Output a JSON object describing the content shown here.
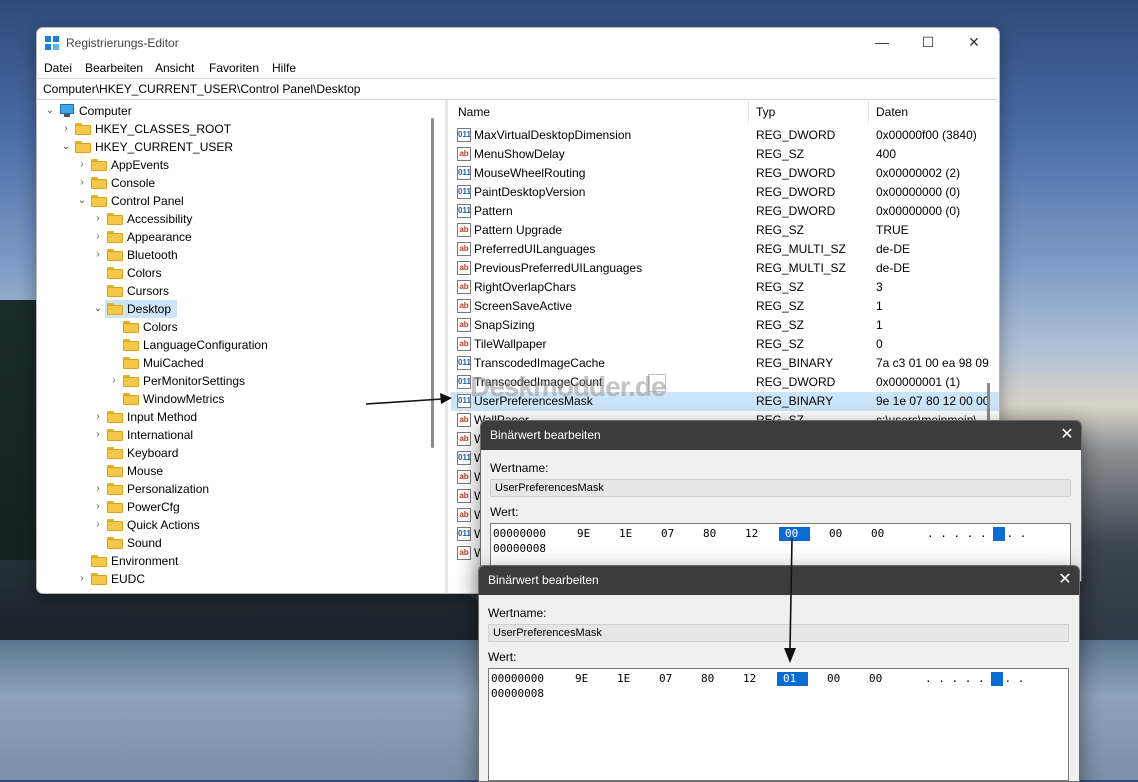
{
  "window": {
    "title": "Registrierungs-Editor",
    "minimize": "—",
    "maximize": "☐",
    "close": "✕"
  },
  "menu": [
    "Datei",
    "Bearbeiten",
    "Ansicht",
    "Favoriten",
    "Hilfe"
  ],
  "address": "Computer\\HKEY_CURRENT_USER\\Control Panel\\Desktop",
  "tree": [
    {
      "label": "Computer",
      "level": 0,
      "arrow": "⌄",
      "icon": "computer-icon"
    },
    {
      "label": "HKEY_CLASSES_ROOT",
      "level": 1,
      "arrow": "›"
    },
    {
      "label": "HKEY_CURRENT_USER",
      "level": 1,
      "arrow": "⌄"
    },
    {
      "label": "AppEvents",
      "level": 2,
      "arrow": "›"
    },
    {
      "label": "Console",
      "level": 2,
      "arrow": "›"
    },
    {
      "label": "Control Panel",
      "level": 2,
      "arrow": "⌄"
    },
    {
      "label": "Accessibility",
      "level": 3,
      "arrow": "›"
    },
    {
      "label": "Appearance",
      "level": 3,
      "arrow": "›"
    },
    {
      "label": "Bluetooth",
      "level": 3,
      "arrow": "›"
    },
    {
      "label": "Colors",
      "level": 3,
      "arrow": ""
    },
    {
      "label": "Cursors",
      "level": 3,
      "arrow": ""
    },
    {
      "label": "Desktop",
      "level": 3,
      "arrow": "⌄",
      "selected": true
    },
    {
      "label": "Colors",
      "level": 4,
      "arrow": ""
    },
    {
      "label": "LanguageConfiguration",
      "level": 4,
      "arrow": ""
    },
    {
      "label": "MuiCached",
      "level": 4,
      "arrow": ""
    },
    {
      "label": "PerMonitorSettings",
      "level": 4,
      "arrow": "›"
    },
    {
      "label": "WindowMetrics",
      "level": 4,
      "arrow": ""
    },
    {
      "label": "Input Method",
      "level": 3,
      "arrow": "›"
    },
    {
      "label": "International",
      "level": 3,
      "arrow": "›"
    },
    {
      "label": "Keyboard",
      "level": 3,
      "arrow": ""
    },
    {
      "label": "Mouse",
      "level": 3,
      "arrow": ""
    },
    {
      "label": "Personalization",
      "level": 3,
      "arrow": "›"
    },
    {
      "label": "PowerCfg",
      "level": 3,
      "arrow": "›"
    },
    {
      "label": "Quick Actions",
      "level": 3,
      "arrow": "›"
    },
    {
      "label": "Sound",
      "level": 3,
      "arrow": ""
    },
    {
      "label": "Environment",
      "level": 2,
      "arrow": ""
    },
    {
      "label": "EUDC",
      "level": 2,
      "arrow": "›"
    }
  ],
  "columns": {
    "name": "Name",
    "type": "Typ",
    "data": "Daten"
  },
  "values": [
    {
      "icon": "bin",
      "name": "MaxVirtualDesktopDimension",
      "type": "REG_DWORD",
      "data": "0x00000f00 (3840)"
    },
    {
      "icon": "ab",
      "name": "MenuShowDelay",
      "type": "REG_SZ",
      "data": "400"
    },
    {
      "icon": "bin",
      "name": "MouseWheelRouting",
      "type": "REG_DWORD",
      "data": "0x00000002 (2)"
    },
    {
      "icon": "bin",
      "name": "PaintDesktopVersion",
      "type": "REG_DWORD",
      "data": "0x00000000 (0)"
    },
    {
      "icon": "bin",
      "name": "Pattern",
      "type": "REG_DWORD",
      "data": "0x00000000 (0)"
    },
    {
      "icon": "ab",
      "name": "Pattern Upgrade",
      "type": "REG_SZ",
      "data": "TRUE"
    },
    {
      "icon": "ab",
      "name": "PreferredUILanguages",
      "type": "REG_MULTI_SZ",
      "data": "de-DE"
    },
    {
      "icon": "ab",
      "name": "PreviousPreferredUILanguages",
      "type": "REG_MULTI_SZ",
      "data": "de-DE"
    },
    {
      "icon": "ab",
      "name": "RightOverlapChars",
      "type": "REG_SZ",
      "data": "3"
    },
    {
      "icon": "ab",
      "name": "ScreenSaveActive",
      "type": "REG_SZ",
      "data": "1"
    },
    {
      "icon": "ab",
      "name": "SnapSizing",
      "type": "REG_SZ",
      "data": "1"
    },
    {
      "icon": "ab",
      "name": "TileWallpaper",
      "type": "REG_SZ",
      "data": "0"
    },
    {
      "icon": "bin",
      "name": "TranscodedImageCache",
      "type": "REG_BINARY",
      "data": "7a c3 01 00 ea 98 09"
    },
    {
      "icon": "bin",
      "name": "TranscodedImageCount",
      "type": "REG_DWORD",
      "data": "0x00000001 (1)"
    },
    {
      "icon": "bin",
      "name": "UserPreferencesMask",
      "type": "REG_BINARY",
      "data": "9e 1e 07 80 12 00 00",
      "selected": true
    },
    {
      "icon": "ab",
      "name": "WallPaper",
      "type": "REG_SZ",
      "data": "c:\\users\\meinmein\\"
    },
    {
      "icon": "ab",
      "name": "W",
      "type": "",
      "data": ""
    },
    {
      "icon": "bin",
      "name": "W",
      "type": "",
      "data": ""
    },
    {
      "icon": "ab",
      "name": "W",
      "type": "",
      "data": ""
    },
    {
      "icon": "ab",
      "name": "W",
      "type": "",
      "data": ""
    },
    {
      "icon": "ab",
      "name": "W",
      "type": "",
      "data": ""
    },
    {
      "icon": "bin",
      "name": "W",
      "type": "",
      "data": ""
    },
    {
      "icon": "ab",
      "name": "W",
      "type": "",
      "data": ""
    }
  ],
  "watermark": "Deskmodder.de",
  "dialog1": {
    "title": "Binärwert bearbeiten",
    "close": "✕",
    "name_label": "Wertname:",
    "name_value": "UserPreferencesMask",
    "value_label": "Wert:",
    "offset1": "00000000",
    "bytes": [
      "9E",
      "1E",
      "07",
      "80",
      "12",
      "00",
      "00",
      "00"
    ],
    "highlight_index": 5,
    "ascii": ". . . . . . . .",
    "ascii_highlight_index": 5,
    "offset2": "00000008"
  },
  "dialog2": {
    "title": "Binärwert bearbeiten",
    "close": "✕",
    "name_label": "Wertname:",
    "name_value": "UserPreferencesMask",
    "value_label": "Wert:",
    "offset1": "00000000",
    "bytes": [
      "9E",
      "1E",
      "07",
      "80",
      "12",
      "01",
      "00",
      "00"
    ],
    "highlight_index": 5,
    "ascii": ". . . . . . . .",
    "ascii_highlight_index": 5,
    "offset2": "00000008"
  },
  "colors": {
    "selection": "#cce4f7",
    "hex_highlight": "#0a6cd0",
    "dialog_title": "#3c3c3c"
  }
}
